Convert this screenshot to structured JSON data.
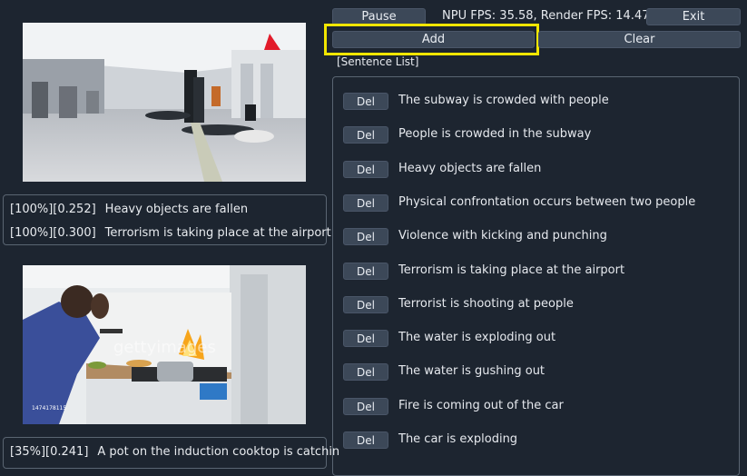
{
  "controls": {
    "pause_label": "Pause",
    "fps_text": "NPU FPS: 35.58, Render FPS: 14.47",
    "exit_label": "Exit",
    "add_label": "Add",
    "clear_label": "Clear",
    "sentence_list_label": "[Sentence List]"
  },
  "video1": {
    "captions": [
      {
        "pct": "[100%][0.252]",
        "text": "Heavy objects are fallen"
      },
      {
        "pct": "[100%][0.300]",
        "text": "Terrorism is taking place at the airport"
      }
    ]
  },
  "video2": {
    "watermark": "gettyimages",
    "id_text": "1474178115",
    "captions": [
      {
        "pct": "[35%][0.241]",
        "text": "A pot on the induction cooktop is catchin"
      }
    ]
  },
  "sentences": [
    {
      "del": "Del",
      "text": "The subway is crowded with people"
    },
    {
      "del": "Del",
      "text": "People is crowded in the subway"
    },
    {
      "del": "Del",
      "text": "Heavy objects are fallen"
    },
    {
      "del": "Del",
      "text": "Physical confrontation occurs between two people"
    },
    {
      "del": "Del",
      "text": "Violence with kicking and punching"
    },
    {
      "del": "Del",
      "text": "Terrorism is taking place at the airport"
    },
    {
      "del": "Del",
      "text": "Terrorist is shooting at people"
    },
    {
      "del": "Del",
      "text": "The water is exploding out"
    },
    {
      "del": "Del",
      "text": "The water is gushing out"
    },
    {
      "del": "Del",
      "text": "Fire is coming out of the car"
    },
    {
      "del": "Del",
      "text": "The car is exploding"
    }
  ],
  "colors": {
    "background": "#1d2530",
    "button": "#3c4858",
    "highlight": "#f2e600"
  }
}
